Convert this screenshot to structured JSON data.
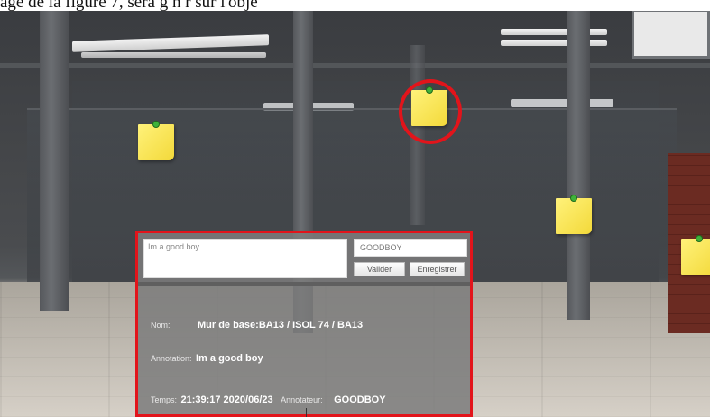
{
  "caption": "age de la figure 7, sera g n r sur l'obje",
  "scene": {
    "highlight_color": "#e2141b",
    "postit_color": "#f6df45",
    "pin_color": "#3fb23a",
    "postit_icon": "sticky-note-icon"
  },
  "annotation_panel": {
    "comment_text": "Im a good boy",
    "annotator_field_value": "GOODBOY",
    "validate_button": "Valider",
    "save_button": "Enregistrer",
    "name_label": "Nom:",
    "name_value": "Mur de base:BA13 / ISOL 74 /  BA13",
    "annotation_label": "Annotation:",
    "annotation_value": "Im a good boy",
    "time_label": "Temps:",
    "time_value": "21:39:17 2020/06/23",
    "annotator_label": "Annotateur:",
    "annotator_value": "GOODBOY"
  }
}
